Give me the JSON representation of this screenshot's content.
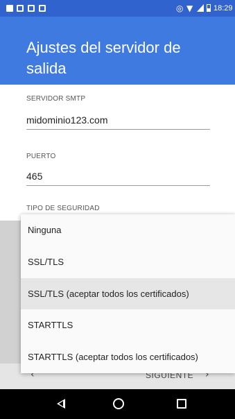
{
  "status_bar": {
    "time": "18:29",
    "left_icons": [
      "app-notification-icon",
      "image-icon",
      "mail-icon",
      "mail-icon"
    ],
    "right_icons": [
      "sync-icon",
      "wifi-icon",
      "signal-icon",
      "battery-icon"
    ]
  },
  "header": {
    "title": "Ajustes del servidor de salida",
    "color": "#3f7ae0",
    "status_color": "#3163cf"
  },
  "form": {
    "smtp_label": "SERVIDOR SMTP",
    "smtp_value": "midominio123.com",
    "port_label": "PUERTO",
    "port_value": "465",
    "security_label": "TIPO DE SEGURIDAD"
  },
  "security_dropdown": {
    "options": [
      "Ninguna",
      "SSL/TLS",
      "SSL/TLS (aceptar todos los certificados)",
      "STARTTLS",
      "STARTTLS (aceptar todos los certificados)"
    ],
    "highlighted_index": 2
  },
  "footer": {
    "back_icon": "‹",
    "next_label": "SIGUIENTE",
    "next_icon": "›"
  },
  "system_nav": {
    "icons": [
      "back-triangle-icon",
      "home-circle-icon",
      "recents-square-icon"
    ]
  }
}
